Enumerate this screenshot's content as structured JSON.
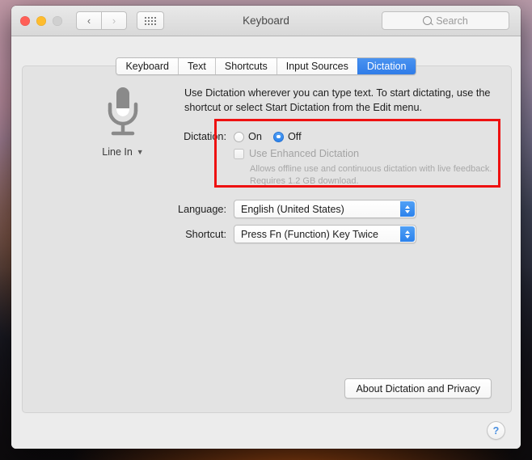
{
  "window": {
    "title": "Keyboard",
    "traffic_lights": [
      "close",
      "minimize",
      "zoom"
    ],
    "nav_back_icon": "chevron-left-icon",
    "nav_forward_icon": "chevron-right-icon",
    "show_all_icon": "grid-icon"
  },
  "search": {
    "placeholder": "Search",
    "icon": "search-icon"
  },
  "tabs": [
    {
      "label": "Keyboard",
      "selected": false
    },
    {
      "label": "Text",
      "selected": false
    },
    {
      "label": "Shortcuts",
      "selected": false
    },
    {
      "label": "Input Sources",
      "selected": false
    },
    {
      "label": "Dictation",
      "selected": true
    }
  ],
  "mic": {
    "icon": "microphone-icon",
    "source_label": "Line In",
    "chevron": "⌄"
  },
  "description": "Use Dictation wherever you can type text. To start dictating, use the shortcut or select Start Dictation from the Edit menu.",
  "dictation": {
    "label": "Dictation:",
    "options": [
      {
        "label": "On",
        "selected": false
      },
      {
        "label": "Off",
        "selected": true
      }
    ],
    "enhanced": {
      "label": "Use Enhanced Dictation",
      "checked": false,
      "enabled": false,
      "help_text": "Allows offline use and continuous dictation with live feedback. Requires 1.2 GB download."
    }
  },
  "language": {
    "label": "Language:",
    "value": "English (United States)"
  },
  "shortcut": {
    "label": "Shortcut:",
    "value": "Press Fn (Function) Key Twice"
  },
  "about_button": {
    "label": "About Dictation and Privacy"
  },
  "help_button": {
    "label": "?",
    "icon": "question-mark-icon"
  },
  "highlight": {
    "color": "#ee1111",
    "target": "dictation-settings-group"
  },
  "colors": {
    "accent_blue": "#2f7ce8",
    "window_bg": "#ececec",
    "panel_bg": "#e3e3e3",
    "highlight_red": "#ee1111",
    "disabled_text": "#a3a3a3"
  }
}
